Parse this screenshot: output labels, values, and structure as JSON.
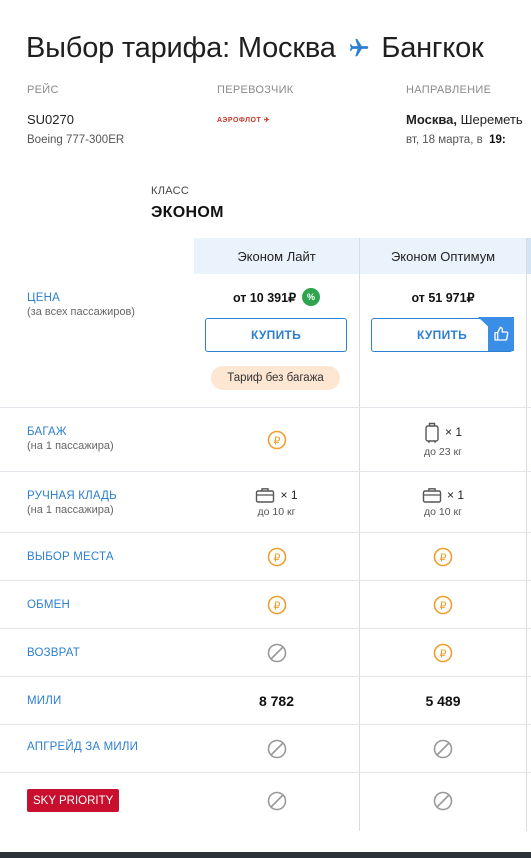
{
  "header": {
    "title_prefix": "Выбор тарифа: Москва",
    "title_suffix": "Бангкок"
  },
  "flight": {
    "flight_label": "РЕЙС",
    "flight_number": "SU0270",
    "aircraft": "Boeing 777-300ER",
    "carrier_label": "ПЕРЕВОЗЧИК",
    "carrier_logo_text": "АЭРОФЛОТ",
    "direction_label": "НАПРАВЛЕНИЕ",
    "direction_city": "Москва,",
    "direction_airport": " Шереметь",
    "direction_date": "вт, 18 марта, в",
    "direction_time": "19:"
  },
  "class_section": {
    "label": "КЛАСС",
    "value": "ЭКОНОМ"
  },
  "columns": [
    {
      "name": "Эконом Лайт"
    },
    {
      "name": "Эконом Оптимум"
    }
  ],
  "rows": {
    "price": {
      "label": "ЦЕНА",
      "sub": "(за всех пассажиров)"
    },
    "baggage": {
      "label": "БАГАЖ",
      "sub": "(на 1 пассажира)"
    },
    "hand": {
      "label": "РУЧНАЯ КЛАДЬ",
      "sub": "(на 1 пассажира)"
    },
    "seat": {
      "label": "ВЫБОР МЕСТА"
    },
    "exchange": {
      "label": "ОБМЕН"
    },
    "refund": {
      "label": "ВОЗВРАТ"
    },
    "miles": {
      "label": "МИЛИ"
    },
    "upgrade": {
      "label": "АПГРЕЙД ЗА МИЛИ"
    },
    "sky": {
      "label": "SKY PRIORITY"
    }
  },
  "lite": {
    "price": "от 10 391₽",
    "discount_badge": "%",
    "buy_label": "КУПИТЬ",
    "no_baggage": "Тариф без багажа",
    "hand_qty": "× 1",
    "hand_weight": "до 10 кг",
    "miles": "8 782"
  },
  "optimum": {
    "price": "от 51 971₽",
    "buy_label": "КУПИТЬ",
    "baggage_qty": "× 1",
    "baggage_weight": "до 23 кг",
    "hand_qty": "× 1",
    "hand_weight": "до 10 кг",
    "miles": "5 489"
  },
  "colors": {
    "accent": "#2d7fd0",
    "paid_icon": "#f0a030",
    "not_available_icon": "#9a9a9a",
    "discount_badge": "#2ea44f",
    "sky_priority": "#c8102e",
    "no_baggage_chip": "#fde6d2",
    "column_header": "#eaf2fb"
  },
  "icons": {
    "paid": "ruble-coin-icon",
    "unavailable": "not-available-icon",
    "suitcase": "suitcase-icon",
    "hand_bag": "hand-luggage-icon",
    "plane": "plane-icon",
    "thumb": "thumbs-up-icon"
  }
}
